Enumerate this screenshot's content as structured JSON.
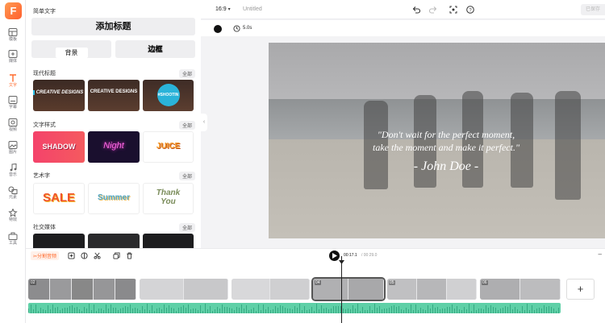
{
  "app": {
    "logo_letter": "F",
    "accent_color": "#ff6a2b"
  },
  "rail": [
    {
      "label": "模板",
      "icon": "template-icon"
    },
    {
      "label": "媒体",
      "icon": "media-icon"
    },
    {
      "label": "文字",
      "icon": "text-icon",
      "active": true
    },
    {
      "label": "字幕",
      "icon": "subtitle-icon"
    },
    {
      "label": "视频",
      "icon": "video-icon"
    },
    {
      "label": "图片",
      "icon": "image-icon"
    },
    {
      "label": "音乐",
      "icon": "music-icon"
    },
    {
      "label": "元素",
      "icon": "elements-icon"
    },
    {
      "label": "特效",
      "icon": "effects-icon"
    },
    {
      "label": "工具",
      "icon": "tools-icon"
    }
  ],
  "panel": {
    "simple_text_title": "简单文字",
    "add_title_button": "添加标题",
    "background_button": "背景",
    "border_button": "边框",
    "sections": [
      {
        "title": "现代标题",
        "all_label": "全部",
        "thumbs": [
          "CREATIVE DESIGNS",
          "CREATIVE DESIGNS",
          "#SHOOTIN"
        ]
      },
      {
        "title": "文字样式",
        "all_label": "全部",
        "thumbs": [
          "SHADOW",
          "Night",
          "JUICE"
        ]
      },
      {
        "title": "艺术字",
        "all_label": "全部",
        "thumbs": [
          "SALE",
          "Summer",
          "Thank You"
        ]
      },
      {
        "title": "社交媒体",
        "all_label": "全部",
        "thumbs": [
          "",
          "",
          ""
        ]
      }
    ]
  },
  "topbar": {
    "aspect_ratio": "16:9",
    "project_title": "Untitled",
    "export_label": "已保存"
  },
  "subbar": {
    "duration": "5.0s"
  },
  "canvas": {
    "quote_line1": "\"Don't wait for the perfect moment,",
    "quote_line2": "take the moment and make it perfect.\"",
    "author": "- John Doe -"
  },
  "timeline": {
    "split_audio_label": "分割音频",
    "current_time": "00:17.1",
    "total_time": "/ 00:29.0",
    "add_label": "+",
    "clips": [
      {
        "number": "02"
      },
      {
        "number": ""
      },
      {
        "number": ""
      },
      {
        "number": "04"
      },
      {
        "number": "05"
      },
      {
        "number": "06"
      }
    ]
  }
}
